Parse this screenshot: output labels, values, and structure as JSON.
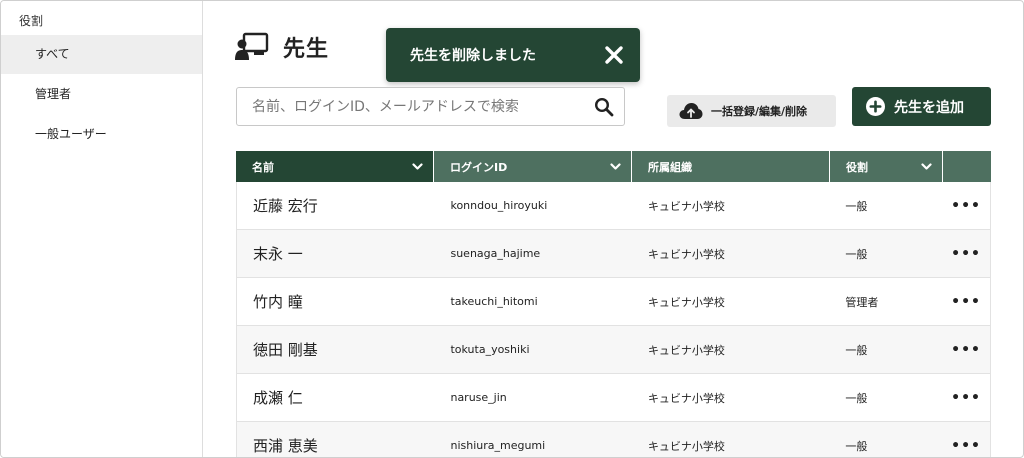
{
  "sidebar": {
    "header": "役割",
    "items": [
      {
        "label": "すべて",
        "active": true
      },
      {
        "label": "管理者",
        "active": false
      },
      {
        "label": "一般ユーザー",
        "active": false
      }
    ]
  },
  "page": {
    "title": "先生",
    "title_icon": "teacher-board-icon"
  },
  "toast": {
    "message": "先生を削除しました",
    "close_icon": "close-icon"
  },
  "search": {
    "placeholder": "名前、ログインID、メールアドレスで検索",
    "value": "",
    "icon": "search-icon"
  },
  "toolbar": {
    "bulk_label": "一括登録/編集/削除",
    "bulk_icon": "cloud-upload-icon",
    "add_label": "先生を追加",
    "add_icon": "plus-circle-icon"
  },
  "table": {
    "columns": [
      {
        "label": "名前",
        "sortable": true
      },
      {
        "label": "ログインID",
        "sortable": true
      },
      {
        "label": "所属組織",
        "sortable": false
      },
      {
        "label": "役割",
        "sortable": true
      },
      {
        "label": "",
        "sortable": false
      }
    ],
    "rows": [
      {
        "name": "近藤 宏行",
        "login_id": "konndou_hiroyuki",
        "org": "キュビナ小学校",
        "role": "一般",
        "menu": "•••"
      },
      {
        "name": "末永 一",
        "login_id": "suenaga_hajime",
        "org": "キュビナ小学校",
        "role": "一般",
        "menu": "•••"
      },
      {
        "name": "竹内 瞳",
        "login_id": "takeuchi_hitomi",
        "org": "キュビナ小学校",
        "role": "管理者",
        "menu": "•••"
      },
      {
        "name": "徳田 剛基",
        "login_id": "tokuta_yoshiki",
        "org": "キュビナ小学校",
        "role": "一般",
        "menu": "•••"
      },
      {
        "name": "成瀬 仁",
        "login_id": "naruse_jin",
        "org": "キュビナ小学校",
        "role": "一般",
        "menu": "•••"
      },
      {
        "name": "西浦 恵美",
        "login_id": "nishiura_megumi",
        "org": "キュビナ小学校",
        "role": "一般",
        "menu": "•••"
      }
    ]
  },
  "colors": {
    "primary": "#244634",
    "header_secondary": "#4e7060",
    "sidebar_active": "#eeeeee"
  }
}
